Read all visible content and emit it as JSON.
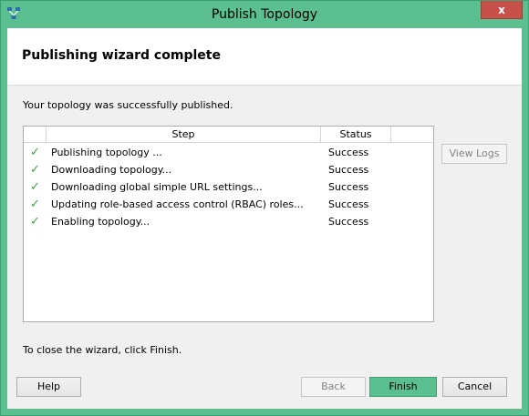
{
  "window": {
    "title": "Publish Topology",
    "close_label": "x"
  },
  "header": {
    "title": "Publishing wizard complete"
  },
  "message": "Your topology was successfully published.",
  "grid": {
    "columns": [
      "Step",
      "Status"
    ],
    "rows": [
      {
        "step": "Publishing topology ...",
        "status": "Success"
      },
      {
        "step": "Downloading topology...",
        "status": "Success"
      },
      {
        "step": "Downloading global simple URL settings...",
        "status": "Success"
      },
      {
        "step": "Updating role-based access control (RBAC) roles...",
        "status": "Success"
      },
      {
        "step": "Enabling topology...",
        "status": "Success"
      }
    ]
  },
  "view_logs_label": "View Logs",
  "footer_hint": "To close the wizard, click Finish.",
  "buttons": {
    "help": "Help",
    "back": "Back",
    "finish": "Finish",
    "cancel": "Cancel"
  },
  "colors": {
    "accent": "#5cbf90",
    "check": "#3aa53a",
    "close": "#c7504b"
  },
  "icons": {
    "app": "topology-icon",
    "check": "check-icon",
    "close": "close-icon"
  }
}
